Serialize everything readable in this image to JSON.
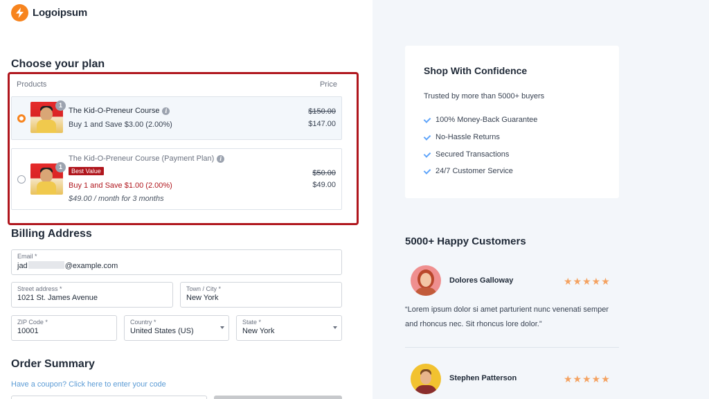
{
  "brand": {
    "name": "Logoipsum",
    "accent": "#f7841e"
  },
  "plan": {
    "title": "Choose your plan",
    "col_products": "Products",
    "col_price": "Price",
    "products": [
      {
        "name": "The Kid-O-Preneur Course",
        "qty": "1",
        "save_text": "Buy 1 and Save $3.00 (2.00%)",
        "old_price": "$150.00",
        "new_price": "$147.00",
        "selected": true
      },
      {
        "name": "The Kid-O-Preneur Course (Payment Plan)",
        "qty": "1",
        "badge": "Best Value",
        "save_text": "Buy 1 and Save $1.00 (2.00%)",
        "monthly": "$49.00 / month for 3 months",
        "old_price": "$50.00",
        "new_price": "$49.00",
        "selected": false
      }
    ],
    "highlight_color": "#b0161d"
  },
  "billing": {
    "title": "Billing Address",
    "email": {
      "label": "Email *",
      "value_start": "jad",
      "value_end": "@example.com"
    },
    "street": {
      "label": "Street address *",
      "value": "1021 St. James Avenue"
    },
    "city": {
      "label": "Town / City *",
      "value": "New York"
    },
    "zip": {
      "label": "ZIP Code *",
      "value": "10001"
    },
    "country": {
      "label": "Country *",
      "value": "United States (US)"
    },
    "state": {
      "label": "State *",
      "value": "New York"
    }
  },
  "order": {
    "title": "Order Summary",
    "coupon_link": "Have a coupon? Click here to enter your code"
  },
  "confidence": {
    "title": "Shop With Confidence",
    "subtitle": "Trusted by more than 5000+ buyers",
    "features": [
      "100% Money-Back Guarantee",
      "No-Hassle Returns",
      "Secured Transactions",
      "24/7 Customer Service"
    ]
  },
  "testimonials": {
    "title": "5000+ Happy Customers",
    "items": [
      {
        "name": "Dolores Galloway",
        "stars": "★★★★★",
        "quote": "“Lorem ipsum dolor si amet parturient nunc venenati semper and rhoncus nec. Sit rhoncus lore dolor.”"
      },
      {
        "name": "Stephen Patterson",
        "stars": "★★★★★"
      }
    ]
  }
}
